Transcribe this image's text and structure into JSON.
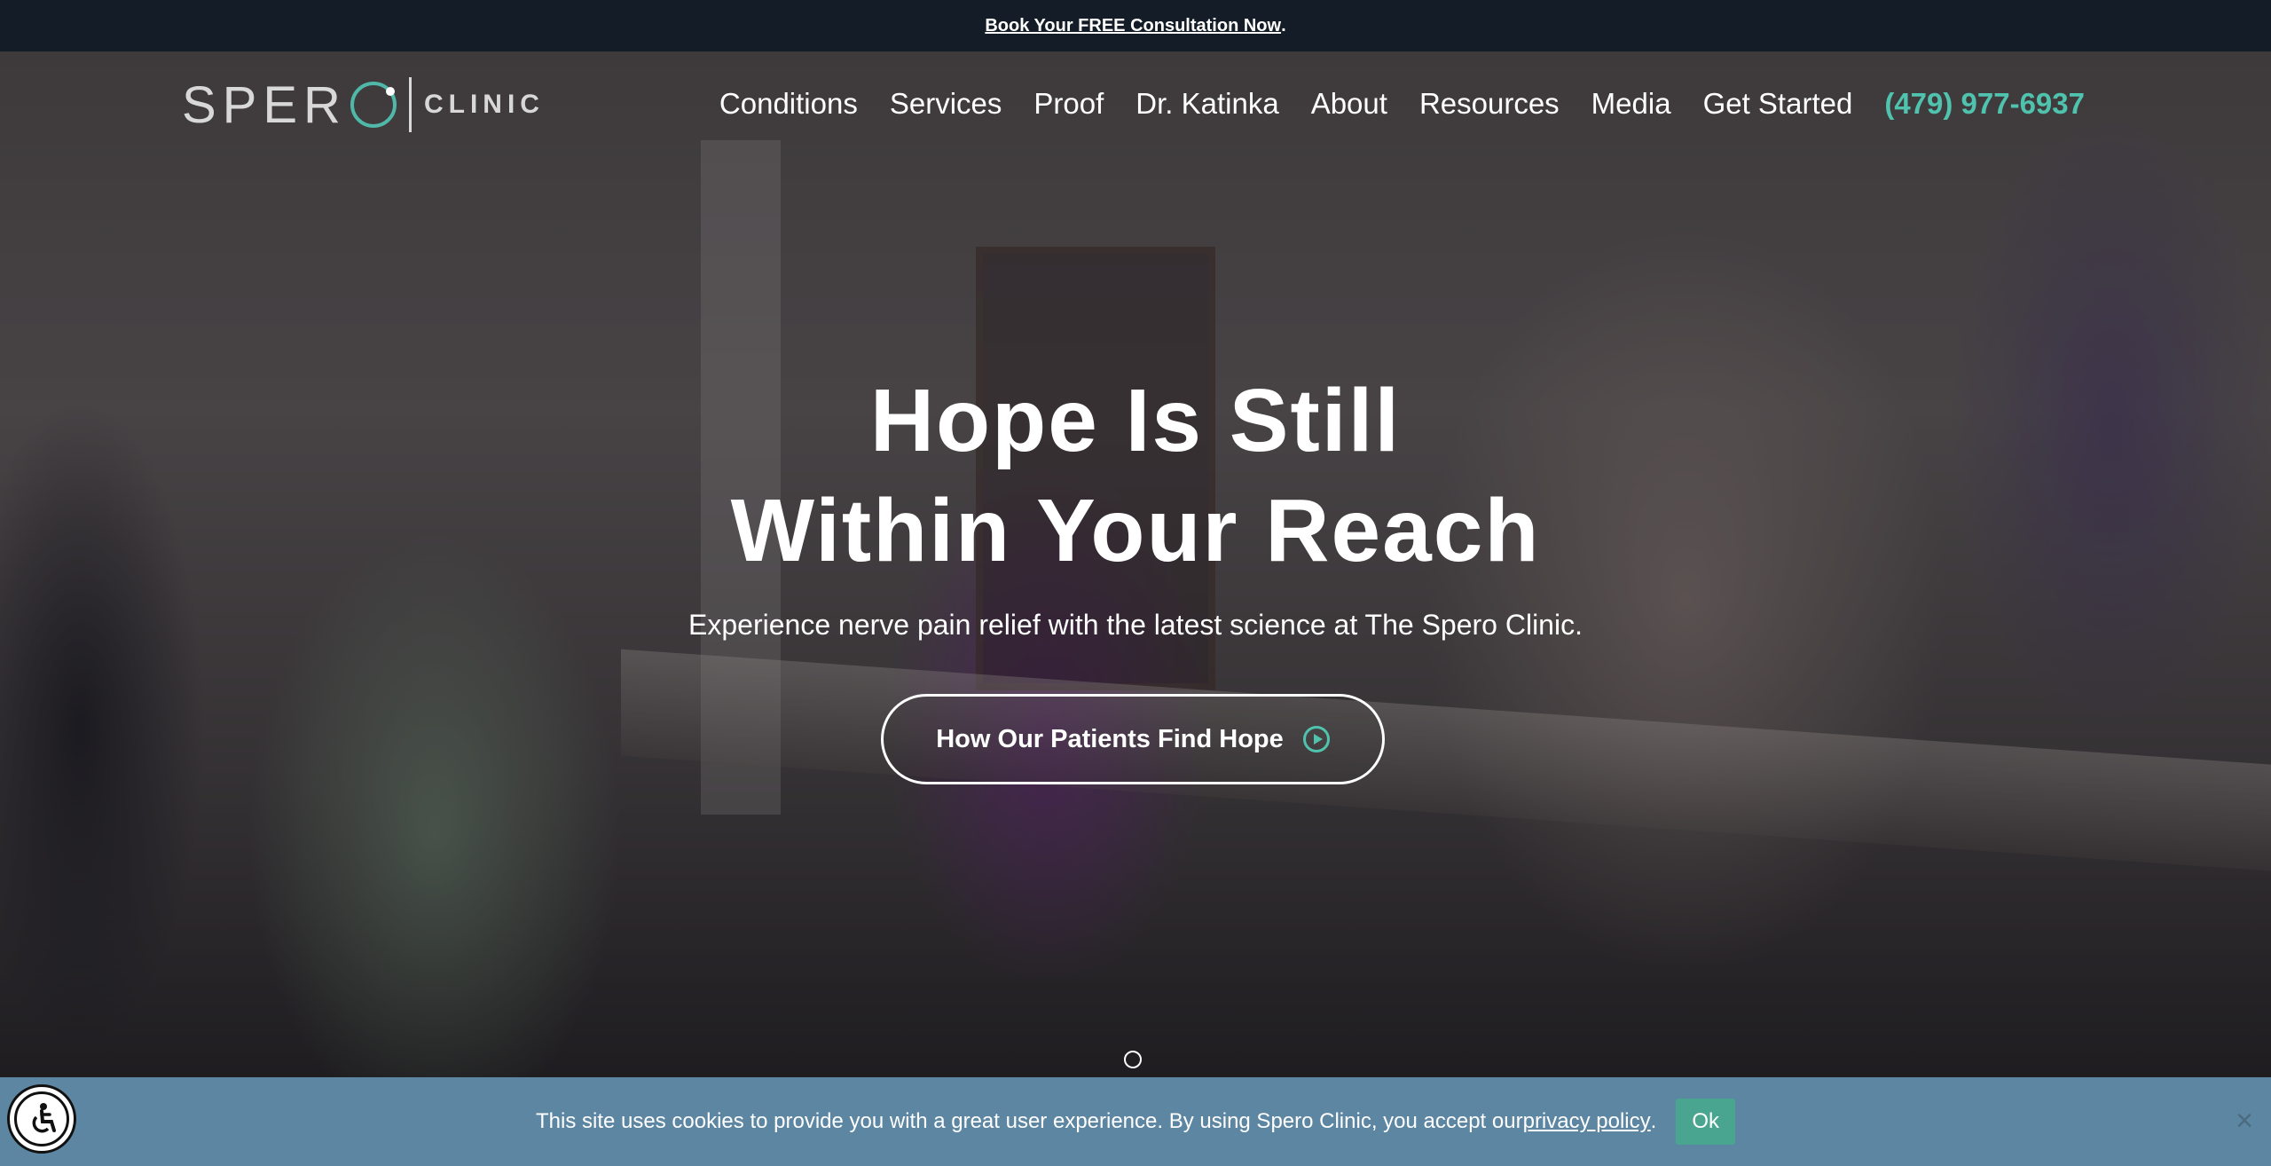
{
  "top_banner": {
    "link_text": "Book Your FREE Consultation Now",
    "suffix": "."
  },
  "logo": {
    "spero": "SPER",
    "clinic": "CLINIC"
  },
  "nav": {
    "items": [
      {
        "label": "Conditions"
      },
      {
        "label": "Services"
      },
      {
        "label": "Proof"
      },
      {
        "label": "Dr. Katinka"
      },
      {
        "label": "About"
      },
      {
        "label": "Resources"
      },
      {
        "label": "Media"
      },
      {
        "label": "Get Started"
      }
    ],
    "phone": "(479) 977-6937"
  },
  "hero": {
    "title_line1": "Hope Is Still",
    "title_line2": "Within Your Reach",
    "subtitle": "Experience nerve pain relief with the latest science at The Spero Clinic.",
    "cta_label": "How Our Patients Find Hope"
  },
  "cookie": {
    "text": "This site uses cookies to provide you with a great user experience. By using Spero Clinic, you accept our ",
    "link": "privacy policy",
    "suffix": ".",
    "ok": "Ok",
    "close": "×"
  },
  "colors": {
    "accent": "#4fc3ad",
    "topbar": "#141d27",
    "cookie_bar": "#5d86a2",
    "ok_button": "#4aa590"
  },
  "icons": [
    "play-circle-icon",
    "accessibility-icon",
    "close-icon"
  ]
}
